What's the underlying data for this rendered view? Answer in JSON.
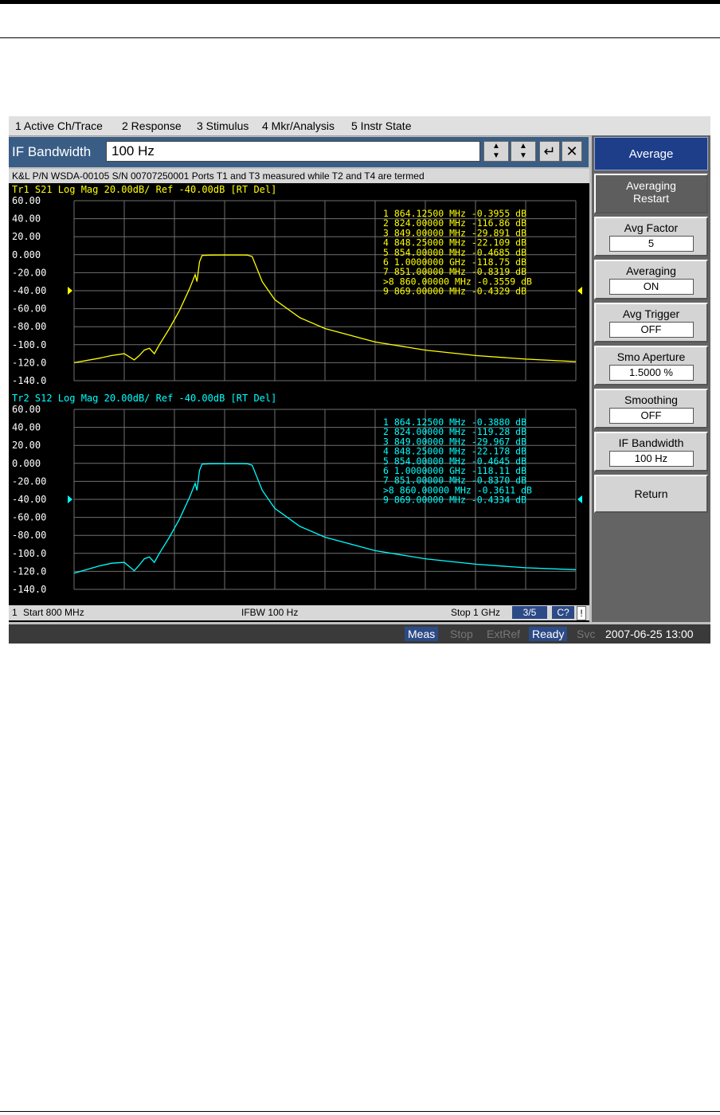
{
  "menu": [
    "1 Active Ch/Trace",
    "2 Response",
    "3 Stimulus",
    "4 Mkr/Analysis",
    "5 Instr State"
  ],
  "entry": {
    "label": "IF Bandwidth",
    "value": "100 Hz"
  },
  "title_line": "K&L P/N WSDA-00105 S/N 00707250001 Ports T1 and T3 measured while T2 and T4 are termed",
  "softkeys": {
    "header": "Average",
    "restart_line1": "Averaging",
    "restart_line2": "Restart",
    "avg_factor": {
      "label": "Avg Factor",
      "value": "5"
    },
    "averaging": {
      "label": "Averaging",
      "value": "ON"
    },
    "avg_trigger": {
      "label": "Avg Trigger",
      "value": "OFF"
    },
    "smo_aperture": {
      "label": "Smo Aperture",
      "value": "1.5000  %"
    },
    "smoothing": {
      "label": "Smoothing",
      "value": "OFF"
    },
    "if_bandwidth": {
      "label": "IF Bandwidth",
      "value": "100 Hz"
    },
    "return": "Return"
  },
  "status": {
    "channel": "1",
    "start": "Start 800 MHz",
    "ifbw": "IFBW 100 Hz",
    "stop": "Stop 1 GHz",
    "page": "3/5",
    "cal": "C?",
    "excl": "!"
  },
  "taskbar": {
    "meas": "Meas",
    "stop": "Stop",
    "extref": "ExtRef",
    "ready": "Ready",
    "svc": "Svc",
    "datetime": "2007-06-25 13:00"
  },
  "colors": {
    "trace1": "#ffff00",
    "trace2": "#00ffff",
    "grid": "#707070"
  },
  "chart_data": [
    {
      "type": "line",
      "trace_label": "Tr1",
      "title": "S21 Log Mag 20.00dB/ Ref -40.00dB [RT Del]",
      "ylim": [
        -140,
        60
      ],
      "ytick_labels": [
        "60.00",
        "40.00",
        "20.00",
        "0.000",
        "-20.00",
        "-40.00",
        "-60.00",
        "-80.00",
        "-100.0",
        "-120.0",
        "-140.0"
      ],
      "xlim_mhz": [
        800,
        1000
      ],
      "ref_level": -40,
      "x": [
        800,
        810,
        815,
        820,
        824,
        826,
        828,
        830,
        832,
        834,
        838,
        842,
        846,
        848.25,
        849,
        850,
        851,
        854,
        860,
        864.125,
        866,
        869,
        871,
        875,
        880,
        890,
        900,
        920,
        940,
        960,
        980,
        1000
      ],
      "y": [
        -120,
        -115,
        -112,
        -110,
        -116.86,
        -112,
        -106,
        -104,
        -110,
        -100,
        -82,
        -62,
        -38,
        -22.109,
        -29.891,
        -8,
        -0.8319,
        -0.4685,
        -0.3559,
        -0.3955,
        -0.3,
        -0.4329,
        -2,
        -30,
        -50,
        -70,
        -82,
        -97,
        -106,
        -112,
        -116,
        -118.75
      ],
      "markers": [
        {
          "n": "1",
          "freq": "864.12500 MHz",
          "val": "-0.3955 dB"
        },
        {
          "n": "2",
          "freq": "824.00000 MHz",
          "val": "-116.86 dB"
        },
        {
          "n": "3",
          "freq": "849.00000 MHz",
          "val": "-29.891 dB"
        },
        {
          "n": "4",
          "freq": "848.25000 MHz",
          "val": "-22.109 dB"
        },
        {
          "n": "5",
          "freq": "854.00000 MHz",
          "val": "-0.4685 dB"
        },
        {
          "n": "6",
          "freq": "1.0000000 GHz",
          "val": "-118.75 dB"
        },
        {
          "n": "7",
          "freq": "851.00000 MHz",
          "val": "-0.8319 dB"
        },
        {
          "n": ">8",
          "freq": "860.00000 MHz",
          "val": "-0.3559 dB"
        },
        {
          "n": "9",
          "freq": "869.00000 MHz",
          "val": "-0.4329 dB"
        }
      ]
    },
    {
      "type": "line",
      "trace_label": "Tr2",
      "title": "S12 Log Mag 20.00dB/ Ref -40.00dB [RT Del]",
      "ylim": [
        -140,
        60
      ],
      "ytick_labels": [
        "60.00",
        "40.00",
        "20.00",
        "0.000",
        "-20.00",
        "-40.00",
        "-60.00",
        "-80.00",
        "-100.0",
        "-120.0",
        "-140.0"
      ],
      "xlim_mhz": [
        800,
        1000
      ],
      "ref_level": -40,
      "x": [
        800,
        810,
        815,
        820,
        824,
        826,
        828,
        830,
        832,
        834,
        838,
        842,
        846,
        848.25,
        849,
        850,
        851,
        854,
        860,
        864.125,
        866,
        869,
        871,
        875,
        880,
        890,
        900,
        920,
        940,
        960,
        980,
        1000
      ],
      "y": [
        -122,
        -114,
        -111,
        -110,
        -119.28,
        -113,
        -106,
        -104,
        -110,
        -100,
        -82,
        -62,
        -38,
        -22.178,
        -29.967,
        -8,
        -0.837,
        -0.4645,
        -0.3611,
        -0.388,
        -0.3,
        -0.4334,
        -2,
        -30,
        -50,
        -70,
        -82,
        -97,
        -106,
        -112,
        -116,
        -118.11
      ],
      "markers": [
        {
          "n": "1",
          "freq": "864.12500 MHz",
          "val": "-0.3880 dB"
        },
        {
          "n": "2",
          "freq": "824.00000 MHz",
          "val": "-119.28 dB"
        },
        {
          "n": "3",
          "freq": "849.00000 MHz",
          "val": "-29.967 dB"
        },
        {
          "n": "4",
          "freq": "848.25000 MHz",
          "val": "-22.178 dB"
        },
        {
          "n": "5",
          "freq": "854.00000 MHz",
          "val": "-0.4645 dB"
        },
        {
          "n": "6",
          "freq": "1.0000000 GHz",
          "val": "-118.11 dB"
        },
        {
          "n": "7",
          "freq": "851.00000 MHz",
          "val": "-0.8370 dB"
        },
        {
          "n": ">8",
          "freq": "860.00000 MHz",
          "val": "-0.3611 dB"
        },
        {
          "n": "9",
          "freq": "869.00000 MHz",
          "val": "-0.4334 dB"
        }
      ]
    }
  ]
}
